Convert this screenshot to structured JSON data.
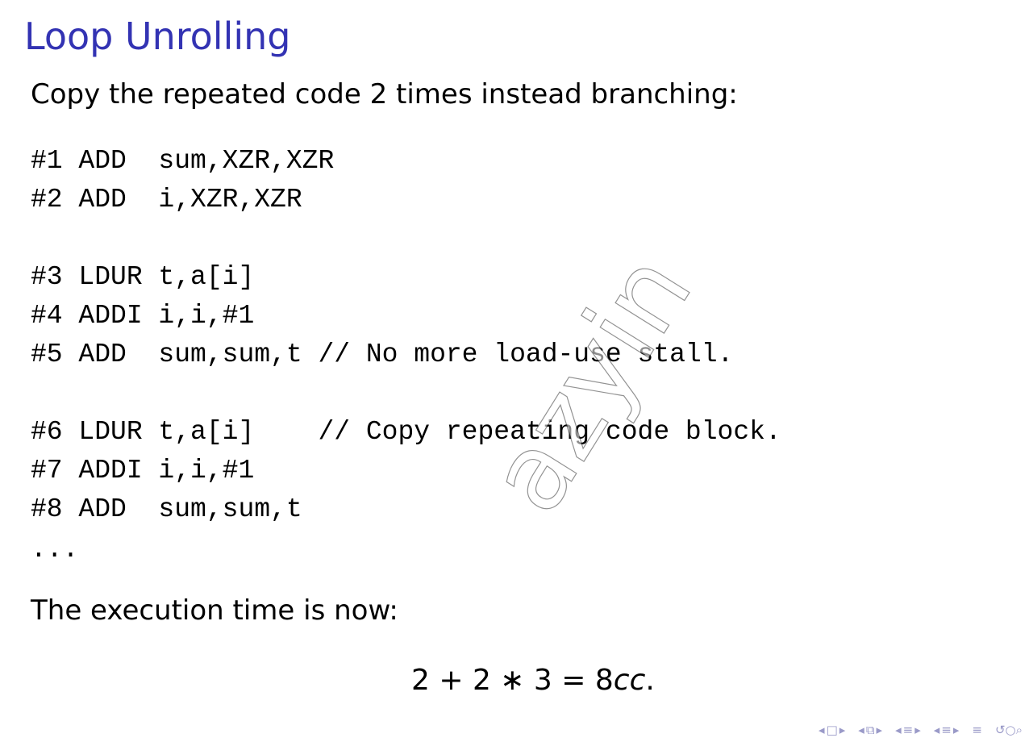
{
  "slide": {
    "title": "Loop Unrolling",
    "intro": "Copy the repeated code 2 times instead branching:",
    "code": [
      "#1 ADD  sum,XZR,XZR",
      "#2 ADD  i,XZR,XZR",
      "#3 LDUR t,a[i]",
      "#4 ADDI i,i,#1",
      "#5 ADD  sum,sum,t // No more load-use stall.",
      "#6 LDUR t,a[i]    // Copy repeating code block.",
      "#7 ADDI i,i,#1",
      "#8 ADD  sum,sum,t",
      "..."
    ],
    "outro": "The execution time is now:",
    "equation": {
      "expression": "2 + 2 ∗ 3 = 8",
      "unit": "cc",
      "end": "."
    }
  },
  "watermark": {
    "text": "azyin"
  },
  "nav": {
    "icons": [
      "first-slide-icon",
      "frame-icon",
      "next-icon",
      "prev-section-icon",
      "section-icon",
      "next-section-icon",
      "prev-subsection-icon",
      "subsection-icon",
      "next-subsection-icon",
      "outline-icon",
      "search-icon"
    ],
    "accent_color": "#9a9ac8"
  },
  "colors": {
    "title": "#3333b3",
    "text": "#000000",
    "background": "#ffffff"
  }
}
